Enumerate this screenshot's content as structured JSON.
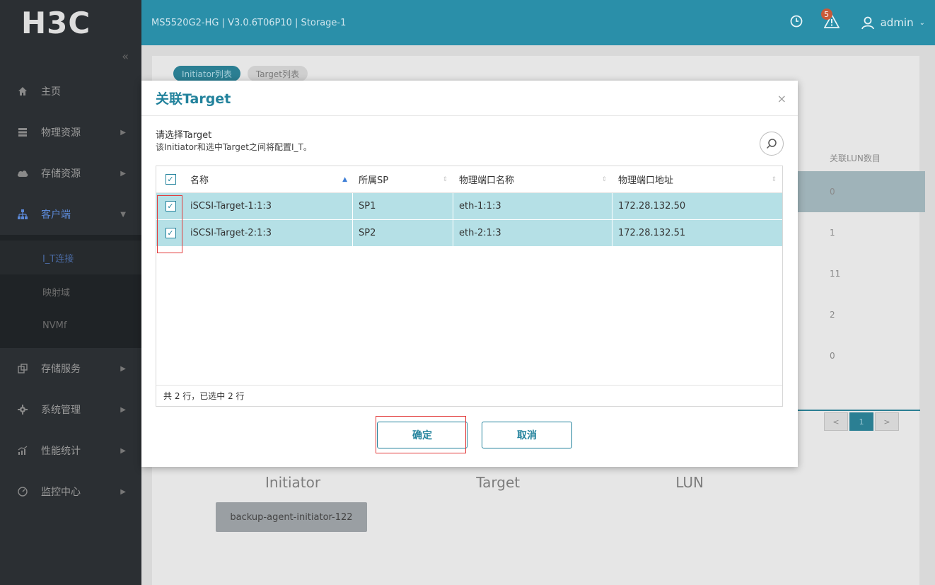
{
  "app": {
    "logo": "H3C",
    "breadcrumb": "MS5520G2-HG | V3.0.6T06P10 | Storage-1",
    "user": "admin",
    "alert_count": "5",
    "collapse_label": "«"
  },
  "sidebar": {
    "items": [
      {
        "label": "主页"
      },
      {
        "label": "物理资源"
      },
      {
        "label": "存储资源"
      },
      {
        "label": "客户端"
      },
      {
        "label": "存储服务"
      },
      {
        "label": "系统管理"
      },
      {
        "label": "性能统计"
      },
      {
        "label": "监控中心"
      }
    ],
    "sub_items": [
      {
        "label": "I_T连接"
      },
      {
        "label": "映射域"
      },
      {
        "label": "NVMf"
      }
    ]
  },
  "background": {
    "tabs": [
      "Initiator列表",
      "Target列表"
    ],
    "right_header": "关联LUN数目",
    "right_values": [
      "0",
      "1",
      "11",
      "2",
      "0"
    ],
    "pager": [
      "<",
      "1",
      ">"
    ],
    "diagram_titles": [
      "Initiator",
      "Target",
      "LUN"
    ],
    "agent_box": "backup-agent-initiator-122"
  },
  "modal": {
    "title": "关联Target",
    "close": "×",
    "prompt": "请选择Target",
    "subprompt": "该Initiator和选中Target之间将配置I_T。",
    "columns": [
      "名称",
      "所属SP",
      "物理端口名称",
      "物理端口地址"
    ],
    "rows": [
      {
        "name": "iSCSI-Target-1:1:3",
        "sp": "SP1",
        "port_name": "eth-1:1:3",
        "port_addr": "172.28.132.50"
      },
      {
        "name": "iSCSI-Target-2:1:3",
        "sp": "SP2",
        "port_name": "eth-2:1:3",
        "port_addr": "172.28.132.51"
      }
    ],
    "footer": "共 2 行，已选中 2 行",
    "ok_label": "确定",
    "cancel_label": "取消"
  },
  "colors": {
    "topbar": "#2a8fa9",
    "accent": "#22829c",
    "selected_row": "#b5e0e6",
    "highlight_box": "#e23b3b"
  }
}
